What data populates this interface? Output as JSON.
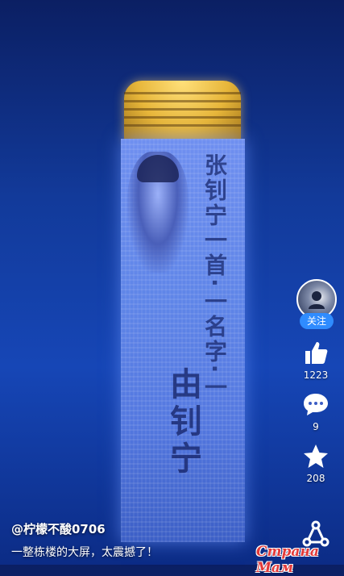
{
  "building_screen": {
    "vertical_text": "张钊宁一首·一名字·一",
    "name_text": "由钊宁"
  },
  "sidebar": {
    "avatar_icon": "user-avatar",
    "follow_label": "关注",
    "actions": [
      {
        "icon": "thumbs-up-icon",
        "count": "1223"
      },
      {
        "icon": "comment-bubble-icon",
        "count": "9"
      },
      {
        "icon": "star-icon",
        "count": "208"
      }
    ],
    "share_icon": "share-icon"
  },
  "caption": {
    "author": "@柠檬不酸0706",
    "description": "一整栋楼的大屏，太震撼了！"
  },
  "watermark": "Страна Мам",
  "colors": {
    "follow_button": "#2f8cff",
    "watermark": "#e23a3a",
    "building_crown": "#e7b63a"
  }
}
